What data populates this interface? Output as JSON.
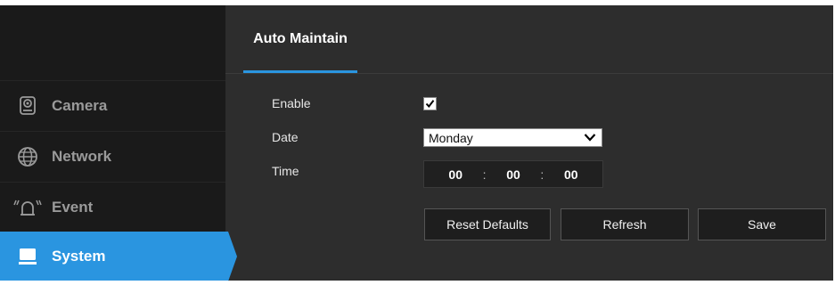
{
  "sidebar": {
    "items": [
      {
        "label": "Camera",
        "icon": "camera-icon"
      },
      {
        "label": "Network",
        "icon": "globe-icon"
      },
      {
        "label": "Event",
        "icon": "alarm-icon"
      },
      {
        "label": "System",
        "icon": "monitor-icon",
        "active": true
      }
    ]
  },
  "tabs": [
    {
      "label": "Auto Maintain",
      "active": true
    }
  ],
  "form": {
    "enable_label": "Enable",
    "enable_checked": true,
    "date_label": "Date",
    "date_value": "Monday",
    "time_label": "Time",
    "time": {
      "hour": "00",
      "minute": "00",
      "second": "00",
      "separator": ":"
    }
  },
  "buttons": {
    "reset": "Reset Defaults",
    "refresh": "Refresh",
    "save": "Save"
  },
  "colors": {
    "accent": "#2a95e0",
    "sidebar_bg": "#1a1a1a",
    "panel_bg": "#2d2d2d"
  }
}
